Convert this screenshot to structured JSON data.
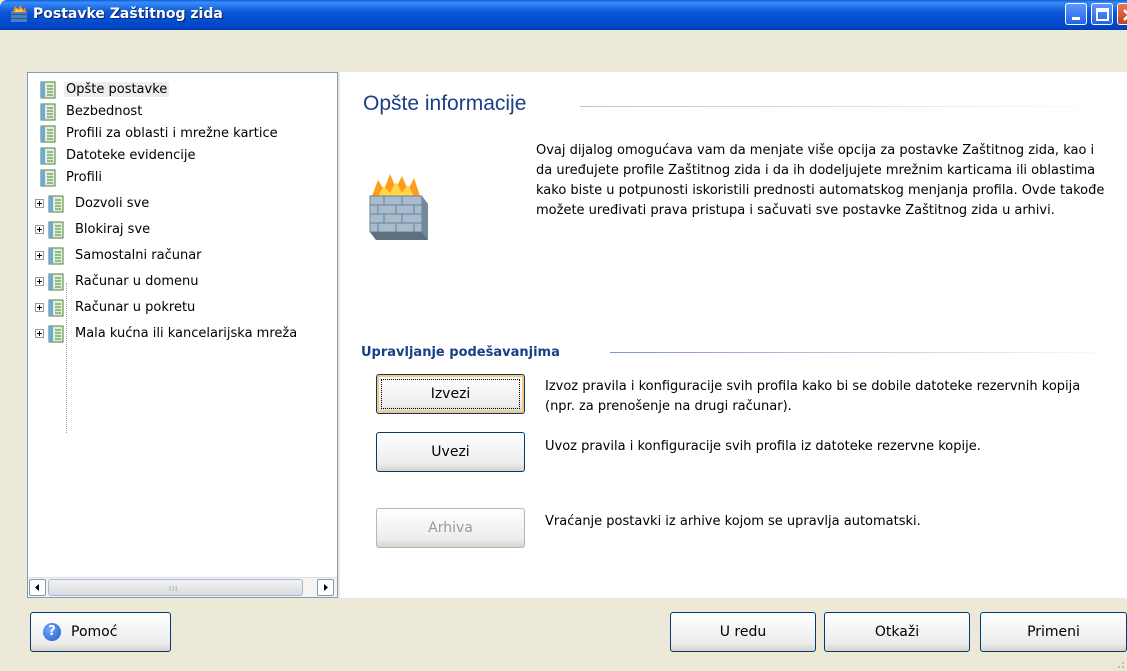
{
  "window": {
    "title": "Postavke Zaštitnog zida"
  },
  "tree": {
    "items": [
      {
        "label": "Opšte postavke",
        "selected": true,
        "level": 0,
        "expandable": false
      },
      {
        "label": "Bezbednost",
        "level": 0,
        "expandable": false
      },
      {
        "label": "Profili za oblasti i mrežne kartice",
        "level": 0,
        "expandable": false
      },
      {
        "label": "Datoteke evidencije",
        "level": 0,
        "expandable": false
      },
      {
        "label": "Profili",
        "level": 0,
        "expandable": false
      },
      {
        "label": "Dozvoli sve",
        "level": 1,
        "expandable": true
      },
      {
        "label": "Blokiraj sve",
        "level": 1,
        "expandable": true
      },
      {
        "label": "Samostalni računar",
        "level": 1,
        "expandable": true
      },
      {
        "label": "Računar u domenu",
        "level": 1,
        "expandable": true
      },
      {
        "label": "Računar u pokretu",
        "level": 1,
        "expandable": true
      },
      {
        "label": "Mala kućna ili kancelarijska mreža",
        "level": 1,
        "expandable": true
      }
    ],
    "scroll_grip": "III"
  },
  "main": {
    "title": "Opšte informacije",
    "intro": "Ovaj dijalog omogućava vam da menjate više opcija za postavke Zaštitnog zida, kao i da uređujete profile Zaštitnog zida i da ih dodeljujete mrežnim karticama ili oblastima kako biste u potpunosti iskoristili prednosti automatskog menjanja profila. Ovde takođe možete uređivati prava pristupa i sačuvati sve postavke Zaštitnog zida u arhivi.",
    "settings_title": "Upravljanje podešavanjima",
    "actions": [
      {
        "label": "Izvezi",
        "description": "Izvoz pravila i konfiguracije svih profila kako bi se dobile datoteke rezervnih kopija (npr. za prenošenje na drugi računar).",
        "state": "focused"
      },
      {
        "label": "Uvezi",
        "description": "Uvoz pravila i konfiguracije svih profila iz datoteke rezervne kopije.",
        "state": "normal"
      },
      {
        "label": "Arhiva",
        "description": "Vraćanje postavki iz arhive kojom se upravlja automatski.",
        "state": "disabled"
      }
    ]
  },
  "footer": {
    "help_label": "Pomoć",
    "ok_label": "U redu",
    "cancel_label": "Otkaži",
    "apply_label": "Primeni"
  }
}
